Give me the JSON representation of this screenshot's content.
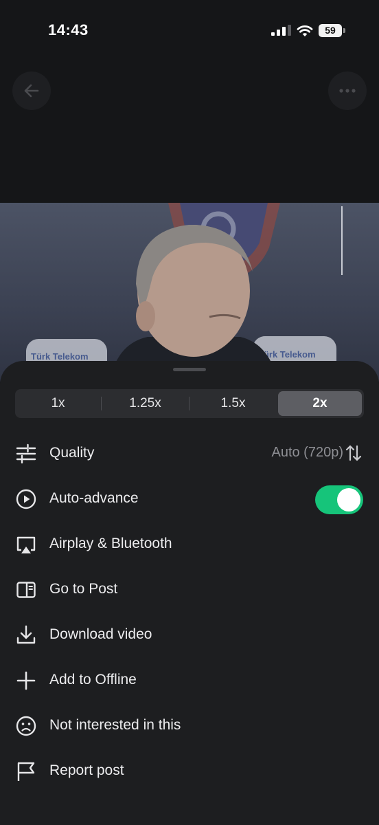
{
  "status_bar": {
    "time": "14:43",
    "battery": "59"
  },
  "video": {
    "sponsor_left": "Türk Telekom",
    "sponsor_right": "Türk Telekom"
  },
  "speed": {
    "options": [
      "1x",
      "1.25x",
      "1.5x",
      "2x"
    ],
    "selected": "2x"
  },
  "menu": {
    "quality": {
      "label": "Quality",
      "value": "Auto (720p)"
    },
    "auto_advance": {
      "label": "Auto-advance",
      "enabled": true
    },
    "airplay": {
      "label": "Airplay & Bluetooth"
    },
    "go_to_post": {
      "label": "Go to Post"
    },
    "download": {
      "label": "Download video"
    },
    "offline": {
      "label": "Add to Offline"
    },
    "not_interested": {
      "label": "Not interested in this"
    },
    "report": {
      "label": "Report post"
    }
  },
  "colors": {
    "toggle_on": "#16c47a",
    "sheet": "#1d1e20",
    "background": "#151618"
  }
}
